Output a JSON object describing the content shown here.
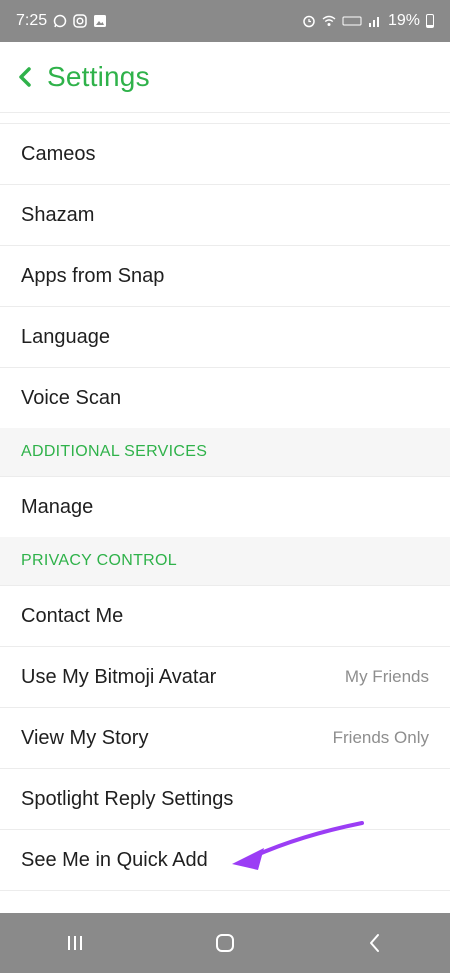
{
  "status_bar": {
    "time": "7:25",
    "battery": "19%",
    "left_icons": [
      "whatsapp-icon",
      "instagram-icon",
      "gallery-icon"
    ],
    "right_icons": [
      "alarm-icon",
      "wifi-icon",
      "volte-icon",
      "signal-icon",
      "battery-icon"
    ]
  },
  "header": {
    "title": "Settings",
    "back_icon": "chevron-left-icon"
  },
  "items_top": [
    {
      "label": "Cameos"
    },
    {
      "label": "Shazam"
    },
    {
      "label": "Apps from Snap"
    },
    {
      "label": "Language"
    },
    {
      "label": "Voice Scan"
    }
  ],
  "section_additional": "ADDITIONAL SERVICES",
  "items_additional": [
    {
      "label": "Manage"
    }
  ],
  "section_privacy": "PRIVACY CONTROL",
  "items_privacy": [
    {
      "label": "Contact Me",
      "value": ""
    },
    {
      "label": "Use My Bitmoji Avatar",
      "value": "My Friends"
    },
    {
      "label": "View My Story",
      "value": "Friends Only"
    },
    {
      "label": "Spotlight Reply Settings",
      "value": ""
    },
    {
      "label": "See Me in Quick Add",
      "value": ""
    }
  ],
  "annotation": {
    "icon": "pointer-arrow-icon",
    "color": "#9b3df5"
  },
  "nav_bar": {
    "icons": [
      "recent-apps-icon",
      "home-icon",
      "back-icon"
    ]
  },
  "colors": {
    "accent": "#2fb24a",
    "status_bar": "#8a8a8a"
  }
}
